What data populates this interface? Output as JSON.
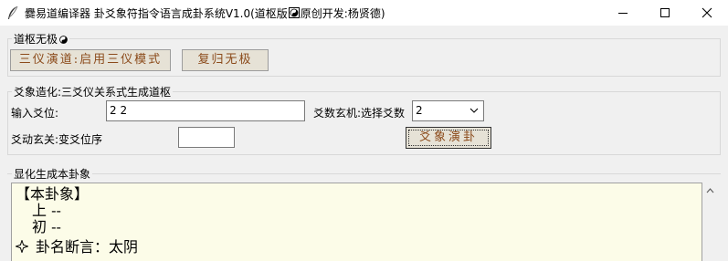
{
  "window": {
    "title": "爨易道编译器 卦爻象符指令语言成卦系统V1.0(道枢版",
    "title_suffix": "原创开发:杨贤德)",
    "app_icon": "feather-quill-icon",
    "controls": [
      "minimize-icon",
      "maximize-icon",
      "close-icon"
    ]
  },
  "group_daoshu": {
    "label": "道枢无极",
    "icon": "yin-yang-icon",
    "btn_sanyi": "三仪演道:启用三仪模式",
    "btn_fugui": "复归无极"
  },
  "group_yaoxiang": {
    "label": "爻象造化:三爻仪关系式生成道枢",
    "input_label": "输入爻位:",
    "input_value": "2 2",
    "select_label": "爻数玄机:选择爻数",
    "select_value": "2",
    "change_label": "爻动玄关:变爻位序",
    "change_value": "",
    "btn_yanGua": "爻象演卦"
  },
  "group_output": {
    "label": "显化生成本卦象",
    "line1": "【本卦象】",
    "line2": "上 --",
    "line3": "初 --",
    "line4": "卦名断言：太阴"
  },
  "colors": {
    "button_text": "#8b4a1a",
    "button_bg": "#e6e2d6",
    "output_bg": "#fcfce8"
  }
}
